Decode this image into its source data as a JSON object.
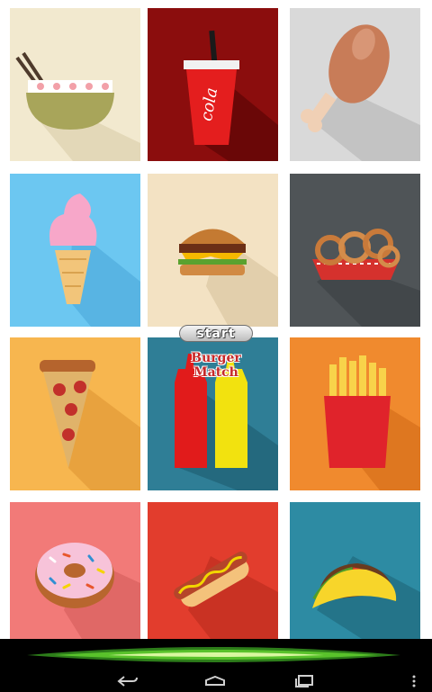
{
  "menu": {
    "start_label": "start",
    "game_title": "Burger Match"
  },
  "tiles": [
    {
      "name": "noodle-bowl",
      "background": "#f2e9cf"
    },
    {
      "name": "cola-cup",
      "background": "#8b0d0d",
      "cup_text": "cola"
    },
    {
      "name": "chicken-drumstick",
      "background": "#d9d9d9"
    },
    {
      "name": "ice-cream-cone",
      "background": "#6cc7f1"
    },
    {
      "name": "burger",
      "background": "#f3e2c3"
    },
    {
      "name": "onion-rings",
      "background": "#4f5457"
    },
    {
      "name": "pizza-slice",
      "background": "#f7b64f"
    },
    {
      "name": "ketchup-mustard",
      "background": "#2f7e96"
    },
    {
      "name": "french-fries",
      "background": "#f08a2e"
    },
    {
      "name": "donut",
      "background": "#f27a78"
    },
    {
      "name": "hot-dog",
      "background": "#e23d2d"
    },
    {
      "name": "taco",
      "background": "#2d8ba3"
    }
  ],
  "navigation": [
    "back-icon",
    "home-icon",
    "recent-apps-icon",
    "overflow-menu-icon"
  ]
}
